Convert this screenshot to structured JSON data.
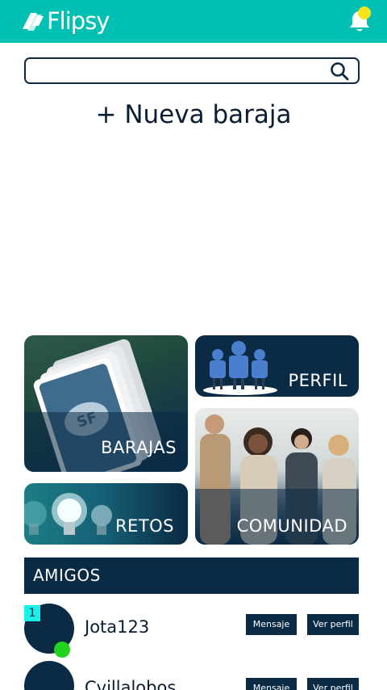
{
  "header": {
    "logo_text": "Flipsy",
    "notification_dot_color": "#f5e31b",
    "bar_color": "#00bfb3"
  },
  "search": {
    "value": "",
    "icon": "search-icon"
  },
  "new_deck": {
    "label": "+ Nueva baraja"
  },
  "tiles": {
    "barajas": "BARAJAS",
    "perfil": "PERFIL",
    "retos": "RETOS",
    "comunidad": "COMUNIDAD"
  },
  "amigos": {
    "title": "AMIGOS",
    "friends": [
      {
        "rank": "1",
        "name": "Jota123",
        "online": true,
        "message_label": "Mensaje",
        "profile_label": "Ver perfil"
      },
      {
        "rank": "",
        "name": "Cvillalobos",
        "online": false,
        "message_label": "Mensaje",
        "profile_label": "Ver perfil"
      }
    ]
  },
  "colors": {
    "primary_dark": "#0b2a44",
    "accent_teal": "#00bfb3",
    "online_green": "#22d31e",
    "rank_cyan": "#19f0e8"
  }
}
